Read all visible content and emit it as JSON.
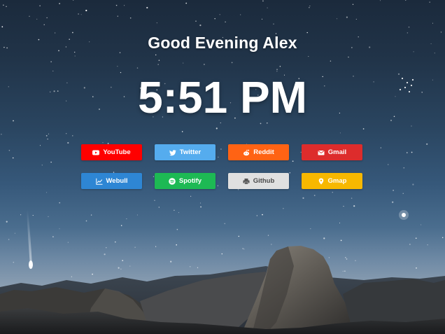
{
  "greeting": "Good Evening Alex",
  "clock": "5:51 PM",
  "links": [
    {
      "label": "YouTube",
      "color": "#ff0000",
      "icon": "youtube-icon"
    },
    {
      "label": "Twitter",
      "color": "#55acee",
      "icon": "twitter-icon"
    },
    {
      "label": "Reddit",
      "color": "#ff6314",
      "icon": "reddit-icon"
    },
    {
      "label": "Gmail",
      "color": "#dd2c2c",
      "icon": "mail-icon"
    },
    {
      "label": "Webull",
      "color": "#2e86d4",
      "icon": "chart-line-icon"
    },
    {
      "label": "Spotify",
      "color": "#1db954",
      "icon": "spotify-icon"
    },
    {
      "label": "Github",
      "color": "#e0e0e0",
      "icon": "printer-icon"
    },
    {
      "label": "Gmap",
      "color": "#f7b800",
      "icon": "map-pin-icon"
    }
  ]
}
